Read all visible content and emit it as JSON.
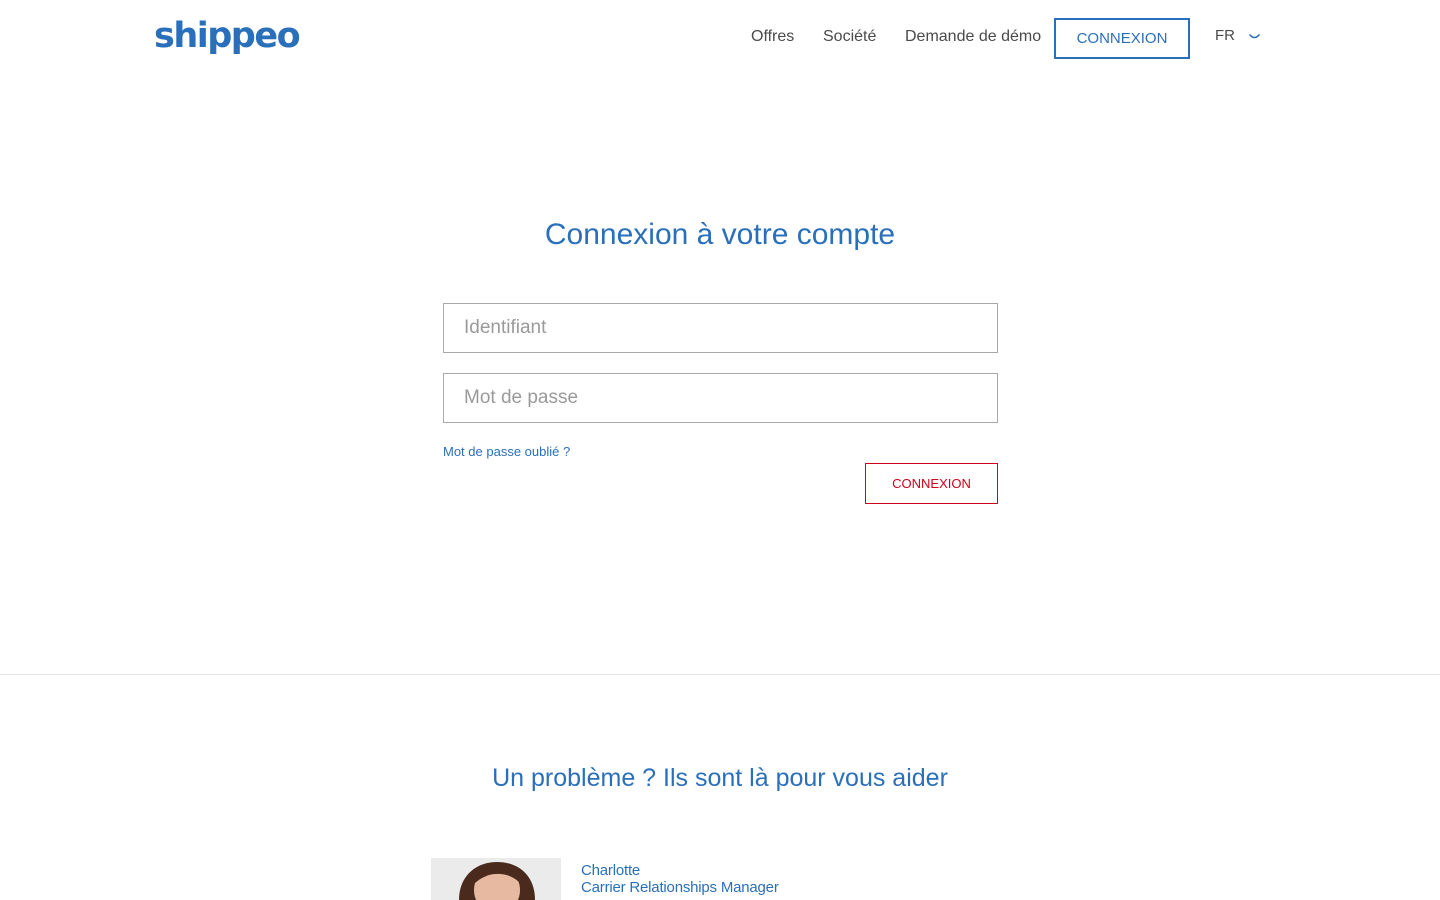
{
  "header": {
    "logo": "shippeo",
    "nav": {
      "offres": "Offres",
      "societe": "Société",
      "demo": "Demande de démo",
      "login": "CONNEXION"
    },
    "language": "FR"
  },
  "login": {
    "title": "Connexion à votre compte",
    "username_placeholder": "Identifiant",
    "password_placeholder": "Mot de passe",
    "forgot_password": "Mot de passe oublié ?",
    "submit": "CONNEXION"
  },
  "help": {
    "title": "Un problème ? Ils sont là pour vous aider",
    "contacts": [
      {
        "name": "Charlotte",
        "role": "Carrier Relationships Manager"
      }
    ]
  },
  "colors": {
    "brand_blue": "#2a6fba",
    "submit_red": "#d0021b"
  },
  "icons": {
    "language_dropdown": "chevron-down-icon"
  }
}
